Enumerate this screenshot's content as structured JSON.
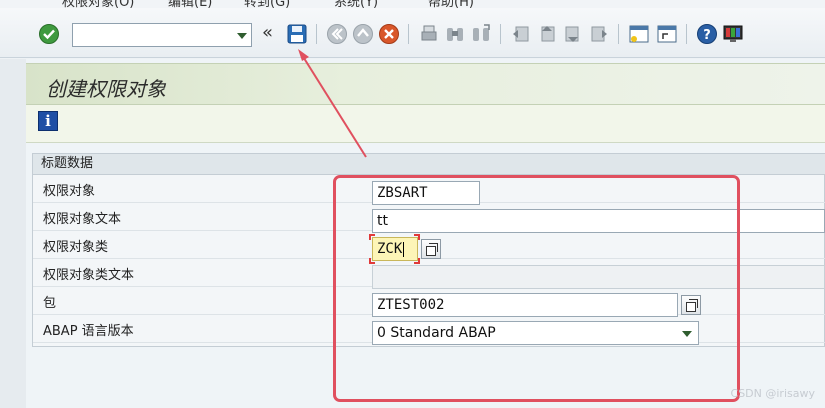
{
  "menubar": {
    "items": [
      "权限对象(O)",
      "编辑(E)",
      "转到(G)",
      "系统(Y)",
      "帮助(H)"
    ]
  },
  "toolbar": {
    "command_field": {
      "value": "",
      "placeholder": ""
    },
    "icons": [
      "enter-icon",
      "save-icon",
      "back-icon",
      "exit-icon",
      "cancel-icon",
      "print-icon",
      "find-icon",
      "find-next-icon",
      "first-page-icon",
      "prev-page-icon",
      "next-page-icon",
      "last-page-icon",
      "new-session-icon",
      "shortcut-icon",
      "help-icon",
      "layout-icon"
    ]
  },
  "page": {
    "title": "创建权限对象"
  },
  "form": {
    "group_title": "标题数据",
    "fields": [
      {
        "label": "权限对象",
        "value": "ZBSART"
      },
      {
        "label": "权限对象文本",
        "value": "tt"
      },
      {
        "label": "权限对象类",
        "value": "ZCK"
      },
      {
        "label": "权限对象类文本",
        "value": ""
      },
      {
        "label": "包",
        "value": "ZTEST002"
      },
      {
        "label": "ABAP 语言版本",
        "value": "0 Standard ABAP"
      }
    ]
  },
  "watermark": "CSDN @irisawy",
  "colors": {
    "annotation": "#e0505f",
    "title_bar": "#d8e3c9",
    "highlight_field": "#fdf5b7"
  }
}
